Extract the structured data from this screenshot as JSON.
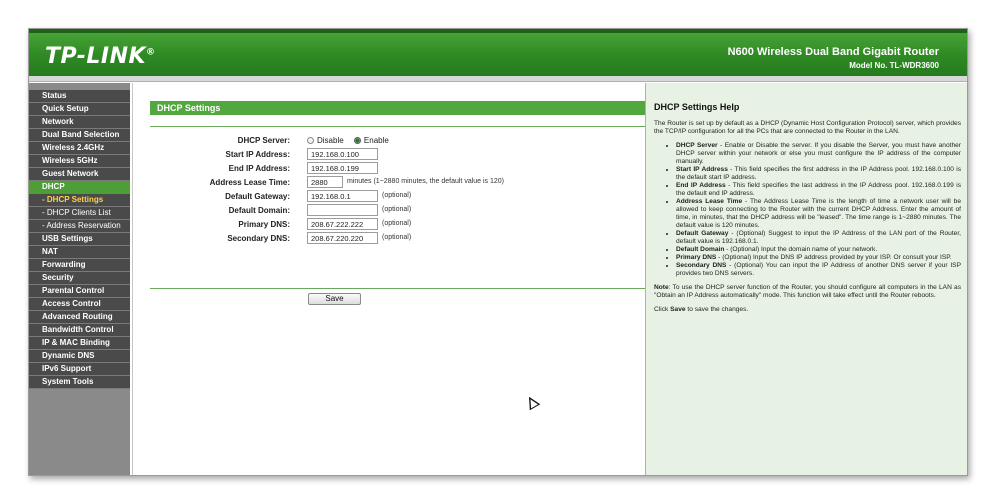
{
  "header": {
    "logo": "TP-LINK",
    "logo_mark": "®",
    "product": "N600 Wireless Dual Band Gigabit Router",
    "model": "Model No. TL-WDR3600"
  },
  "sidebar": {
    "items": [
      {
        "label": "Status"
      },
      {
        "label": "Quick Setup"
      },
      {
        "label": "Network"
      },
      {
        "label": "Dual Band Selection"
      },
      {
        "label": "Wireless 2.4GHz"
      },
      {
        "label": "Wireless 5GHz"
      },
      {
        "label": "Guest Network"
      },
      {
        "label": "DHCP"
      },
      {
        "label": "- DHCP Settings"
      },
      {
        "label": "- DHCP Clients List"
      },
      {
        "label": "- Address Reservation"
      },
      {
        "label": "USB Settings"
      },
      {
        "label": "NAT"
      },
      {
        "label": "Forwarding"
      },
      {
        "label": "Security"
      },
      {
        "label": "Parental Control"
      },
      {
        "label": "Access Control"
      },
      {
        "label": "Advanced Routing"
      },
      {
        "label": "Bandwidth Control"
      },
      {
        "label": "IP & MAC Binding"
      },
      {
        "label": "Dynamic DNS"
      },
      {
        "label": "IPv6 Support"
      },
      {
        "label": "System Tools"
      }
    ]
  },
  "main": {
    "title": "DHCP Settings",
    "form": {
      "dhcp_server": {
        "label": "DHCP Server:",
        "disable": "Disable",
        "enable": "Enable",
        "selected": "Enable"
      },
      "start_ip": {
        "label": "Start IP Address:",
        "value": "192.168.0.100"
      },
      "end_ip": {
        "label": "End IP Address:",
        "value": "192.168.0.199"
      },
      "lease_time": {
        "label": "Address Lease Time:",
        "value": "2880",
        "note": "minutes (1~2880 minutes, the default value is 120)"
      },
      "gateway": {
        "label": "Default Gateway:",
        "value": "192.168.0.1",
        "note": "(optional)"
      },
      "domain": {
        "label": "Default Domain:",
        "value": "",
        "note": "(optional)"
      },
      "primary_dns": {
        "label": "Primary DNS:",
        "value": "208.67.222.222",
        "note": "(optional)"
      },
      "secondary_dns": {
        "label": "Secondary DNS:",
        "value": "208.67.220.220",
        "note": "(optional)"
      }
    },
    "save_label": "Save"
  },
  "help": {
    "title": "DHCP Settings Help",
    "intro": "The Router is set up by default as a DHCP (Dynamic Host Configuration Protocol) server, which provides the TCP/IP configuration for all the PCs that are connected to the Router in the LAN.",
    "items": [
      {
        "term": "DHCP Server",
        "text": " - Enable or Disable the server. If you disable the Server, you must have another DHCP server within your network or else you must configure the IP address of the computer manually."
      },
      {
        "term": "Start IP Address",
        "text": " - This field specifies the first address in the IP Address pool. 192.168.0.100 is the default start IP address."
      },
      {
        "term": "End IP Address",
        "text": " - This field specifies the last address in the IP Address pool. 192.168.0.199 is the default end IP address."
      },
      {
        "term": "Address Lease Time",
        "text": " - The Address Lease Time is the length of time a network user will be allowed to keep connecting to the Router with the current DHCP Address. Enter the amount of time, in minutes, that the DHCP address will be \"leased\". The time range is 1~2880 minutes. The default value is 120 minutes."
      },
      {
        "term": "Default Gateway",
        "text": " - (Optional) Suggest to input the IP Address of the LAN port of the Router, default value is 192.168.0.1."
      },
      {
        "term": "Default Domain",
        "text": " - (Optional) Input the domain name of your network."
      },
      {
        "term": "Primary DNS",
        "text": " - (Optional) Input the DNS IP address provided by your ISP. Or consult your ISP."
      },
      {
        "term": "Secondary DNS",
        "text": " - (Optional) You can input the IP Address of another DNS server if your ISP provides two DNS servers."
      }
    ],
    "note_term": "Note",
    "note": ": To use the DHCP server function of the Router, you should configure all computers in the LAN as \"Obtain an IP Address automatically\" mode. This function will take effect until the Router reboots.",
    "click_pre": "Click ",
    "click_term": "Save",
    "click_post": " to save the changes."
  },
  "colors": {
    "brand_green": "#2f8a24",
    "section_green": "#52a83e",
    "help_bg": "#e8f2e4",
    "sidebar_item": "#4a4a4a",
    "sidebar_active": "#4d9e36"
  }
}
